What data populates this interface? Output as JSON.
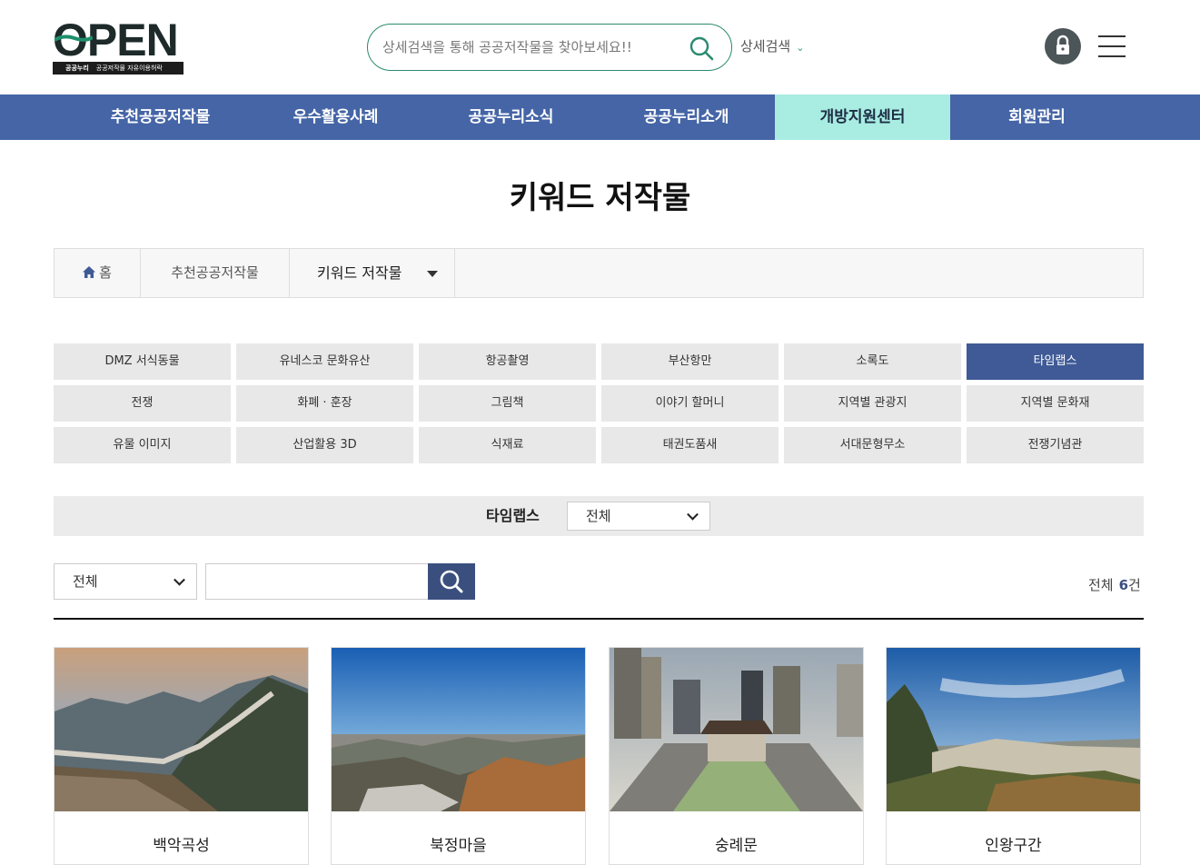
{
  "header": {
    "logo_word": "OPEN",
    "logo_brand": "공공누리",
    "logo_slogan": "공공저작물 자유이용허락",
    "search_placeholder": "상세검색을 통해 공공저작물을 찾아보세요!!",
    "detail_search_label": "상세검색"
  },
  "gnb": [
    {
      "label": "추천공공저작물",
      "active": false
    },
    {
      "label": "우수활용사례",
      "active": false
    },
    {
      "label": "공공누리소식",
      "active": false
    },
    {
      "label": "공공누리소개",
      "active": false
    },
    {
      "label": "개방지원센터",
      "active": true
    },
    {
      "label": "회원관리",
      "active": false
    }
  ],
  "page_title": "키워드 저작물",
  "breadcrumb": {
    "home": "홈",
    "level1": "추천공공저작물",
    "level2": "키워드 저작물"
  },
  "keywords": [
    {
      "label": "DMZ 서식동물",
      "active": false
    },
    {
      "label": "유네스코 문화유산",
      "active": false
    },
    {
      "label": "항공촬영",
      "active": false
    },
    {
      "label": "부산항만",
      "active": false
    },
    {
      "label": "소록도",
      "active": false
    },
    {
      "label": "타임랩스",
      "active": true
    },
    {
      "label": "전쟁",
      "active": false
    },
    {
      "label": "화폐 · 훈장",
      "active": false
    },
    {
      "label": "그림책",
      "active": false
    },
    {
      "label": "이야기 할머니",
      "active": false
    },
    {
      "label": "지역별 관광지",
      "active": false
    },
    {
      "label": "지역별 문화재",
      "active": false
    },
    {
      "label": "유물 이미지",
      "active": false
    },
    {
      "label": "산업활용 3D",
      "active": false
    },
    {
      "label": "식재료",
      "active": false
    },
    {
      "label": "태권도품새",
      "active": false
    },
    {
      "label": "서대문형무소",
      "active": false
    },
    {
      "label": "전쟁기념관",
      "active": false
    }
  ],
  "filter": {
    "label": "타임랩스",
    "selected": "전체"
  },
  "search": {
    "category_selected": "전체",
    "keyword_value": "",
    "total_label": "전체",
    "total_count": "6",
    "total_unit": "건"
  },
  "cards": [
    {
      "title": "백악곡성"
    },
    {
      "title": "북정마을"
    },
    {
      "title": "숭례문"
    },
    {
      "title": "인왕구간"
    }
  ],
  "colors": {
    "nav_bg": "#4565a6",
    "nav_active_bg": "#a8ece2",
    "keyword_active_bg": "#3f5a96",
    "search_border": "#2a8a6f",
    "search_button_bg": "#3b4f7f"
  }
}
